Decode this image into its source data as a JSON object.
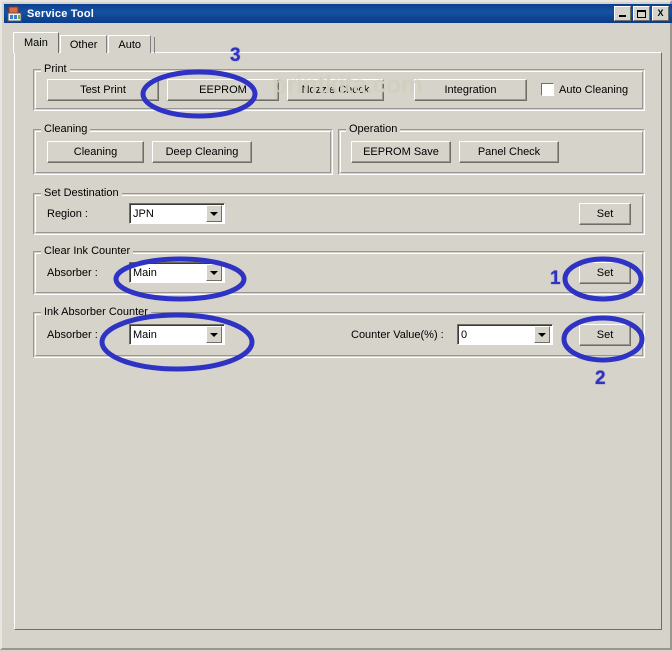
{
  "window": {
    "title": "Service Tool",
    "icon": "app-icon",
    "controls": {
      "minimize": "minimize-icon",
      "maximize": "maximize-icon",
      "close": "X"
    }
  },
  "tabs": [
    {
      "label": "Main",
      "active": true
    },
    {
      "label": "Other",
      "active": false
    },
    {
      "label": "Auto",
      "active": false
    }
  ],
  "watermark": "printkita.com",
  "groups": {
    "print": {
      "label": "Print",
      "buttons": [
        {
          "label": "Test Print"
        },
        {
          "label": "EEPROM"
        },
        {
          "label": "Nozzle Check"
        },
        {
          "label": "Integration"
        }
      ],
      "checkbox": {
        "label": "Auto Cleaning",
        "checked": false
      }
    },
    "cleaning": {
      "label": "Cleaning",
      "buttons": [
        {
          "label": "Cleaning"
        },
        {
          "label": "Deep Cleaning"
        }
      ]
    },
    "operation": {
      "label": "Operation",
      "buttons": [
        {
          "label": "EEPROM Save"
        },
        {
          "label": "Panel Check"
        }
      ]
    },
    "set_destination": {
      "label": "Set Destination",
      "region_label": "Region :",
      "region_value": "JPN",
      "set_label": "Set"
    },
    "clear_ink_counter": {
      "label": "Clear Ink Counter",
      "absorber_label": "Absorber :",
      "absorber_value": "Main",
      "set_label": "Set"
    },
    "ink_absorber_counter": {
      "label": "Ink Absorber Counter",
      "absorber_label": "Absorber :",
      "absorber_value": "Main",
      "counter_label": "Counter Value(%) :",
      "counter_value": "0",
      "set_label": "Set"
    }
  },
  "annotations": {
    "color": "#2f33c4",
    "steps": [
      {
        "number": "1",
        "target": "clear-ink-counter-set-button"
      },
      {
        "number": "2",
        "target": "ink-absorber-counter-set-button"
      },
      {
        "number": "3",
        "target": "eeprom-button"
      }
    ]
  }
}
